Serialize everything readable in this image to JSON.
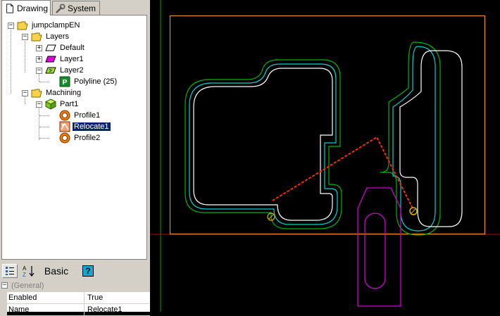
{
  "tabs": [
    {
      "label": "Drawing",
      "icon": "drawing-document-icon",
      "active": true
    },
    {
      "label": "System",
      "icon": "wrench-icon",
      "active": false
    }
  ],
  "tree": {
    "root": "jumpclampEN",
    "layers": "Layers",
    "layer_items": [
      "Default",
      "Layer1",
      "Layer2"
    ],
    "polyline": "Polyline (25)",
    "machining": "Machining",
    "part": "Part1",
    "ops": [
      "Profile1",
      "Relocate1",
      "Profile2"
    ],
    "selected": "Relocate1"
  },
  "toolbar": {
    "basic_label": "Basic",
    "sort_az": "A Z",
    "help": "?"
  },
  "properties": {
    "section": "(General)",
    "rows": [
      {
        "name": "Enabled",
        "value": "True"
      },
      {
        "name": "Name",
        "value": "Relocate1"
      }
    ]
  },
  "colors": {
    "stock_outline": "#ff9b1e",
    "profile_inner": "#ffffff",
    "profile_cyan": "#00d0d0",
    "profile_green": "#00b400",
    "relocate_line": "#ff2a00",
    "clamp_magenta": "#d000d0",
    "origin_marker": "#d8b000",
    "selection": "#0a246a"
  }
}
